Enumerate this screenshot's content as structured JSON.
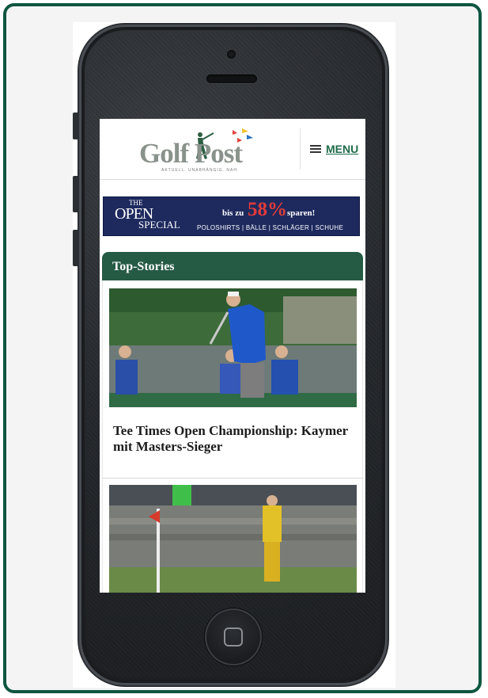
{
  "site": {
    "logo_text": "Golf Post",
    "logo_tagline": "AKTUELL. UNABHÄNGIG. NAH.",
    "menu_label": "MENU"
  },
  "banner": {
    "the": "THE",
    "open": "OPEN",
    "special": "SPECIAL",
    "promo_prefix": "bis zu",
    "percent": "58%",
    "promo_suffix": "sparen!",
    "items": "POLOSHIRTS | BÄLLE | SCHLÄGER | SCHUHE"
  },
  "section": {
    "title": "Top-Stories"
  },
  "stories": [
    {
      "headline": "Tee Times Open Championship: Kaymer mit Masters-Sieger"
    }
  ],
  "colors": {
    "frame": "#0d5640",
    "section_header": "#255a44",
    "banner_bg": "#1e2a5e",
    "promo_red": "#e23b3b",
    "menu_green": "#1f6b4a"
  }
}
